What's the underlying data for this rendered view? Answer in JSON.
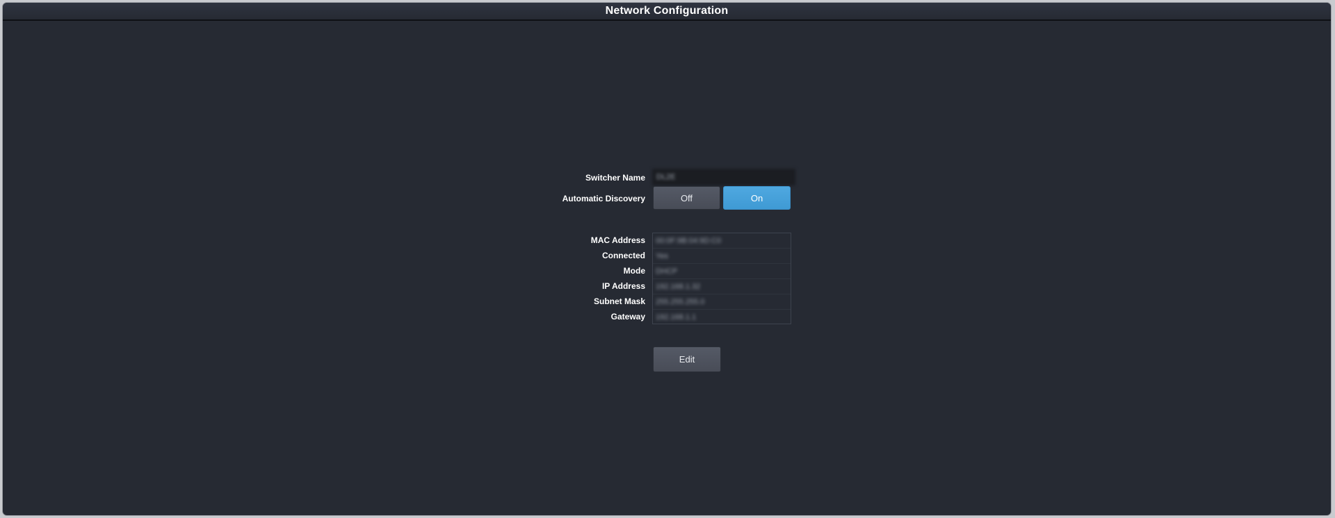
{
  "window": {
    "title": "Network Configuration"
  },
  "form": {
    "switcher_name_label": "Switcher Name",
    "switcher_name_value": "DL2E",
    "auto_discovery_label": "Automatic Discovery",
    "auto_discovery_off": "Off",
    "auto_discovery_on": "On",
    "auto_discovery_selected": "On"
  },
  "info": {
    "rows": [
      {
        "label": "MAC Address",
        "value": "00:0F:9B:04:9D:C0"
      },
      {
        "label": "Connected",
        "value": "Yes"
      },
      {
        "label": "Mode",
        "value": "DHCP"
      },
      {
        "label": "IP Address",
        "value": "192.168.1.32"
      },
      {
        "label": "Subnet Mask",
        "value": "255.255.255.0"
      },
      {
        "label": "Gateway",
        "value": "192.168.1.1"
      }
    ]
  },
  "actions": {
    "edit_label": "Edit"
  },
  "colors": {
    "background": "#262a33",
    "accent_on": "#4aa3dc",
    "button_off": "#505560"
  }
}
